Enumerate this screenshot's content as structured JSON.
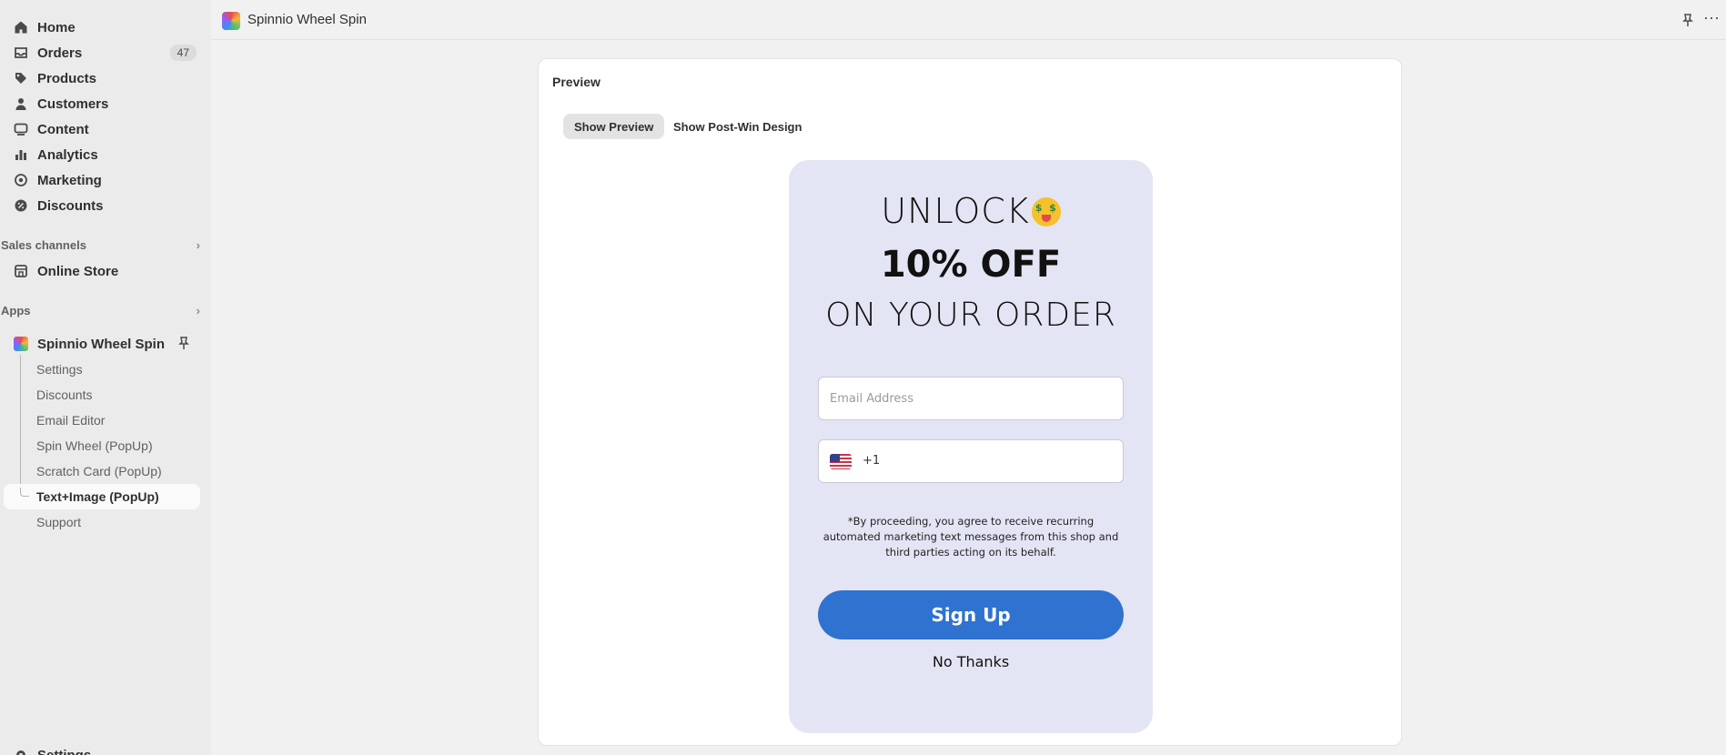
{
  "sidebar": {
    "items": [
      {
        "label": "Home",
        "icon": "home-icon"
      },
      {
        "label": "Orders",
        "icon": "inbox-icon",
        "badge": "47"
      },
      {
        "label": "Products",
        "icon": "tag-icon"
      },
      {
        "label": "Customers",
        "icon": "person-icon"
      },
      {
        "label": "Content",
        "icon": "content-icon"
      },
      {
        "label": "Analytics",
        "icon": "bar-chart-icon"
      },
      {
        "label": "Marketing",
        "icon": "target-icon"
      },
      {
        "label": "Discounts",
        "icon": "discount-icon"
      }
    ],
    "sales_channels": {
      "heading": "Sales channels",
      "items": [
        {
          "label": "Online Store"
        }
      ]
    },
    "apps": {
      "heading": "Apps",
      "app_name": "Spinnio Wheel Spin",
      "sub_items": [
        "Settings",
        "Discounts",
        "Email Editor",
        "Spin Wheel (PopUp)",
        "Scratch Card (PopUp)",
        "Text+Image (PopUp)",
        "Support"
      ]
    },
    "footer_settings": "Settings"
  },
  "topbar": {
    "title": "Spinnio Wheel Spin"
  },
  "card": {
    "title": "Preview",
    "tabs": [
      {
        "label": "Show Preview",
        "active": true
      },
      {
        "label": "Show Post-Win Design",
        "active": false
      }
    ]
  },
  "popup": {
    "line1": "UNLOCK",
    "line2": "10% OFF",
    "line3": "ON YOUR ORDER",
    "email_placeholder": "Email Address",
    "phone_code": "+1",
    "disclaimer": "*By proceeding, you agree to receive recurring automated marketing text messages from this shop and third parties acting on its behalf.",
    "signup_label": "Sign Up",
    "decline_label": "No Thanks",
    "colors": {
      "background": "#e4e5f4",
      "button": "#2f72d0"
    }
  }
}
